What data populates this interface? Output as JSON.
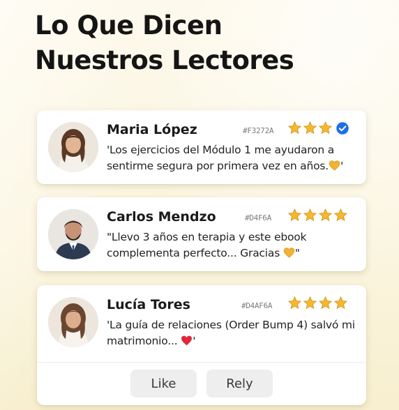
{
  "page": {
    "title_line1": "Lo Que Dicen",
    "title_line2": "Nuestros Lectores"
  },
  "colors": {
    "star": "#F5B82E",
    "verified": "#1D6FE8",
    "heart_gold": "#F2B233",
    "heart_red": "#E0283A"
  },
  "reviews": [
    {
      "name": "Maria López",
      "hex": "#F3272A",
      "stars": 3,
      "verified": true,
      "quote": "'Los ejercicios del Módulo 1 me ayudaron a sentirme segura por primera vez en años.",
      "emoji": "gold-heart-icon",
      "quote_end": "'"
    },
    {
      "name": "Carlos Mendzo",
      "hex": "#D4F6A",
      "stars": 4,
      "verified": false,
      "quote": "\"Llevo 3 años en terapia y este ebook complementa perfecto... Gracias",
      "emoji": "gold-heart-icon",
      "quote_end": "\""
    },
    {
      "name": "Lucía Tores",
      "hex": "#D4AF6A",
      "stars": 4,
      "verified": false,
      "quote": "'La guía de relaciones (Order Bump 4) salvó mi matrimonio...",
      "emoji": "red-heart-icon",
      "quote_end": "'"
    }
  ],
  "actions": {
    "like_label": "Like",
    "reply_label": "Rely"
  }
}
